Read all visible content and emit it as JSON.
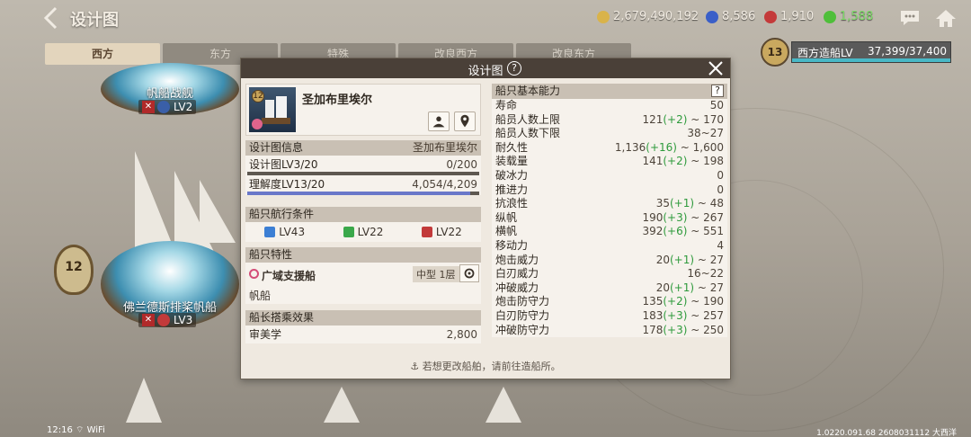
{
  "header": {
    "title": "设计图"
  },
  "resources": [
    {
      "icon": "coin-icon",
      "value": "2,679,490,192",
      "color": "#d9b34a"
    },
    {
      "icon": "blue-gem-icon",
      "value": "8,586",
      "color": "#3a5fc8"
    },
    {
      "icon": "red-gem-icon",
      "value": "1,910",
      "color": "#c43a3a"
    },
    {
      "icon": "green-token-icon",
      "value": "1,588",
      "color": "#4fbf3a"
    }
  ],
  "tabs": [
    {
      "label": "西方",
      "active": true
    },
    {
      "label": "东方",
      "active": false
    },
    {
      "label": "特殊",
      "active": false
    },
    {
      "label": "改良西方",
      "active": false
    },
    {
      "label": "改良东方",
      "active": false
    }
  ],
  "level_panel": {
    "badge": "13",
    "label": "西方造船LV",
    "value": "37,399/37,400",
    "progress": 0.9999
  },
  "ships_left": [
    {
      "name": "帆船战舰",
      "level": "LV2"
    },
    {
      "name": "佛兰德斯排桨帆船",
      "level": "LV3",
      "badge": "12"
    }
  ],
  "dialog": {
    "title": "设计图",
    "ship": {
      "name": "圣加布里埃尔",
      "star": "12"
    },
    "design_info": {
      "header": "设计图信息",
      "header_value": "圣加布里埃尔",
      "design_level": "设计图LV3/20",
      "design_value": "0/200",
      "design_progress": 0.0,
      "understanding": "理解度LV13/20",
      "understanding_value": "4,054/4,209",
      "understanding_progress": 0.963
    },
    "sail_conditions": {
      "header": "船只航行条件",
      "items": [
        {
          "icon": "adventure-icon",
          "label": "LV43",
          "color": "#3c7fd4"
        },
        {
          "icon": "trade-icon",
          "label": "LV22",
          "color": "#3aa84a"
        },
        {
          "icon": "battle-icon",
          "label": "LV22",
          "color": "#c23a3a"
        }
      ]
    },
    "ship_traits": {
      "header": "船只特性",
      "name": "广域支援船",
      "size": "中型 1层",
      "type": "帆船"
    },
    "captain_effect": {
      "header": "船长搭乘效果",
      "name": "审美学",
      "value": "2,800"
    },
    "stats": {
      "header": "船只基本能力",
      "help": "?",
      "rows": [
        {
          "label": "寿命",
          "base": "50",
          "plus": "",
          "tail": ""
        },
        {
          "label": "船员人数上限",
          "base": "121",
          "plus": "(+2)",
          "tail": " ~ 170"
        },
        {
          "label": "船员人数下限",
          "base": "38~27",
          "plus": "",
          "tail": ""
        },
        {
          "label": "耐久性",
          "base": "1,136",
          "plus": "(+16)",
          "tail": " ~ 1,600"
        },
        {
          "label": "装载量",
          "base": "141",
          "plus": "(+2)",
          "tail": " ~ 198"
        },
        {
          "label": "破冰力",
          "base": "0",
          "plus": "",
          "tail": ""
        },
        {
          "label": "推进力",
          "base": "0",
          "plus": "",
          "tail": ""
        },
        {
          "label": "抗浪性",
          "base": "35",
          "plus": "(+1)",
          "tail": " ~ 48"
        },
        {
          "label": "纵帆",
          "base": "190",
          "plus": "(+3)",
          "tail": " ~ 267"
        },
        {
          "label": "横帆",
          "base": "392",
          "plus": "(+6)",
          "tail": " ~ 551"
        },
        {
          "label": "移动力",
          "base": "4",
          "plus": "",
          "tail": ""
        },
        {
          "label": "炮击威力",
          "base": "20",
          "plus": "(+1)",
          "tail": " ~ 27"
        },
        {
          "label": "白刃威力",
          "base": "16~22",
          "plus": "",
          "tail": ""
        },
        {
          "label": "冲破威力",
          "base": "20",
          "plus": "(+1)",
          "tail": " ~ 27"
        },
        {
          "label": "炮击防守力",
          "base": "135",
          "plus": "(+2)",
          "tail": " ~ 190"
        },
        {
          "label": "白刃防守力",
          "base": "183",
          "plus": "(+3)",
          "tail": " ~ 257"
        },
        {
          "label": "冲破防守力",
          "base": "178",
          "plus": "(+3)",
          "tail": " ~ 250"
        }
      ]
    },
    "footer": "若想更改船舶，请前往造船所。"
  },
  "status": {
    "time": "12:16",
    "wifi": "WiFi"
  },
  "version": "1.0220.091.68 2608031112 大西洋"
}
